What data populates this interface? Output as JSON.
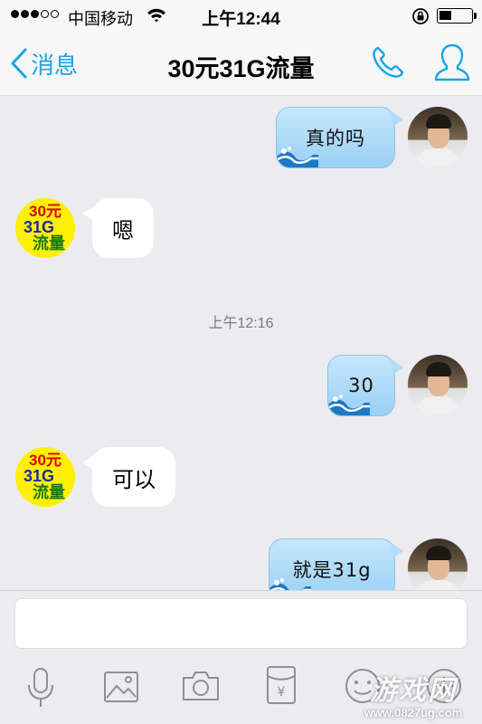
{
  "status_bar": {
    "carrier": "中国移动",
    "time": "上午12:44",
    "signal_bars_filled": 3,
    "signal_bars_total": 5,
    "battery_level": 0.4
  },
  "nav": {
    "back_label": "消息",
    "title": "30元31G流量"
  },
  "contact_avatar": {
    "line1": "30元",
    "line2": "31G",
    "line3": "流量"
  },
  "messages": [
    {
      "sender": "me",
      "text": "真的吗"
    },
    {
      "sender": "other",
      "text": "嗯"
    },
    {
      "sender": "me",
      "text": "30"
    },
    {
      "sender": "other",
      "text": "可以"
    },
    {
      "sender": "me",
      "text": "就是31g"
    }
  ],
  "timestamp": "上午12:16",
  "input": {
    "value": "",
    "placeholder": ""
  },
  "toolbar_icons": [
    "microphone-icon",
    "image-icon",
    "camera-icon",
    "red-packet-icon",
    "emoji-icon",
    "plus-icon"
  ],
  "watermark": {
    "main": "游戏网",
    "url": "www.0827ug.com"
  },
  "colors": {
    "accent": "#1aa3e8",
    "my_bubble": "#a9d7f7",
    "other_bubble": "#ffffff",
    "background": "#ebebf0"
  }
}
